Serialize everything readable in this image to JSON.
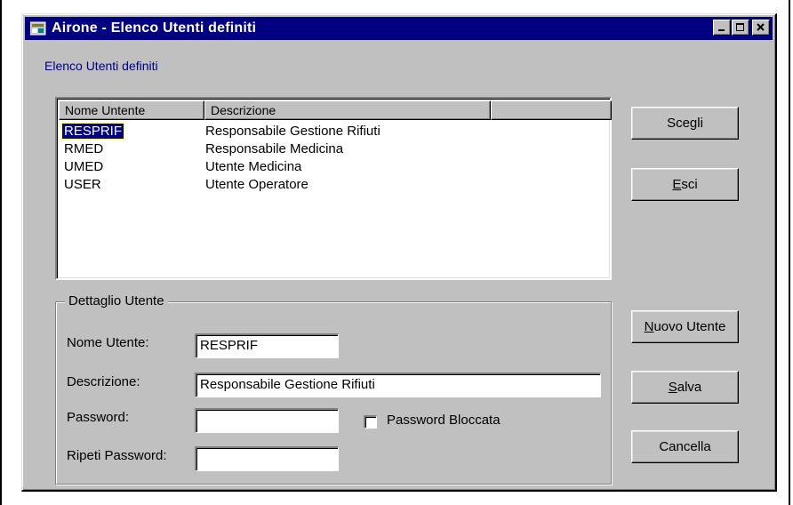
{
  "window": {
    "title": "Airone - Elenco Utenti definiti",
    "minimize_icon": "minimize-icon",
    "maximize_icon": "maximize-icon",
    "close_icon": "close-icon"
  },
  "header_label": "Elenco Utenti definiti",
  "list": {
    "columns": [
      "Nome Untente",
      "Descrizione",
      ""
    ],
    "rows": [
      {
        "name": "RESPRIF",
        "description": "Responsabile Gestione Rifiuti",
        "selected": true
      },
      {
        "name": "RMED",
        "description": "Responsabile Medicina",
        "selected": false
      },
      {
        "name": "UMED",
        "description": "Utente Medicina",
        "selected": false
      },
      {
        "name": "USER",
        "description": "Utente Operatore",
        "selected": false
      }
    ]
  },
  "buttons": {
    "scegli": "Scegli",
    "esci_mnemonic": "E",
    "esci_rest": "sci",
    "nuovo_mnemonic": "N",
    "nuovo_rest": "uovo Utente",
    "salva_mnemonic": "S",
    "salva_rest": "alva",
    "cancella": "Cancella"
  },
  "details": {
    "legend": "Dettaglio Utente",
    "name_label": "Nome Utente:",
    "name_value": "RESPRIF",
    "description_label": "Descrizione:",
    "description_value": "Responsabile Gestione Rifiuti",
    "password_label": "Password:",
    "password_value": "",
    "repeat_label": "Ripeti Password:",
    "repeat_value": "",
    "locked_label": "Password Bloccata",
    "locked_checked": false
  },
  "colors": {
    "titlebar": "#000080",
    "face": "#c0c0c0",
    "selection": "#000080"
  }
}
